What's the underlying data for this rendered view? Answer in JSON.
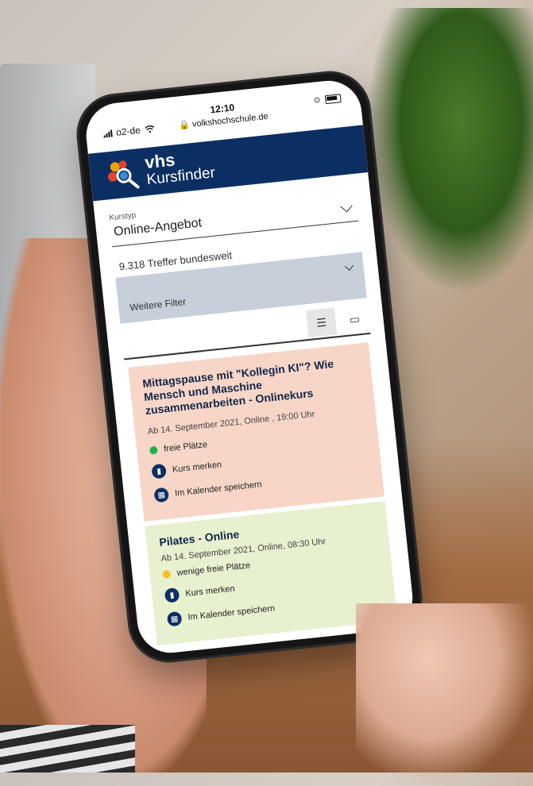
{
  "status": {
    "carrier": "o2-de",
    "time": "12:10",
    "url": "volkshochschule.de"
  },
  "brand": {
    "line1": "vhs",
    "line2": "Kursfinder"
  },
  "filter": {
    "label": "Kurstyp",
    "value": "Online-Angebot",
    "hits": "9.318 Treffer bundesweit",
    "more": "Weitere Filter"
  },
  "courses": [
    {
      "title": "Mittagspause mit \"Kollegin KI\"? Wie Mensch und Maschine zusammenarbeiten - Onlinekurs",
      "date": "Ab 14. September 2021, Online , 19:00 Uhr",
      "availability": "freie Plätze",
      "availability_color": "#22b14c",
      "bookmark": "Kurs merken",
      "calendar": "Im Kalender speichern"
    },
    {
      "title": "Pilates - Online",
      "date": "Ab 14. September 2021, Online, 08:30 Uhr",
      "availability": "wenige freie Plätze",
      "availability_color": "#f5c21b",
      "bookmark": "Kurs merken",
      "calendar": "Im Kalender speichern"
    }
  ],
  "colors": {
    "header": "#0b2f63",
    "card1": "#f7d6c7",
    "card2": "#e7f0cf",
    "filterbar": "#c6cfda"
  }
}
